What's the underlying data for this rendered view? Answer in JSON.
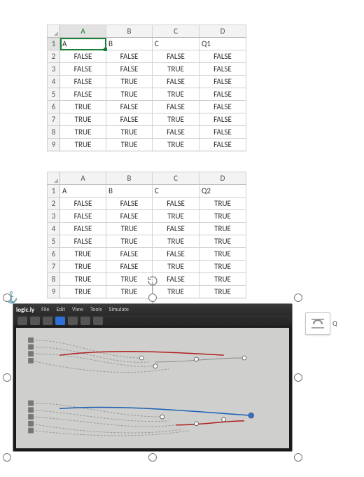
{
  "tables": [
    {
      "active_cell": {
        "row": 0,
        "col": 0
      },
      "columns": [
        "A",
        "B",
        "C",
        "D"
      ],
      "rows": [
        "1",
        "2",
        "3",
        "4",
        "5",
        "6",
        "7",
        "8",
        "9"
      ],
      "header_row": [
        "A",
        "B",
        "C",
        "Q1"
      ],
      "data": [
        [
          "FALSE",
          "FALSE",
          "FALSE",
          "FALSE"
        ],
        [
          "FALSE",
          "FALSE",
          "TRUE",
          "FALSE"
        ],
        [
          "FALSE",
          "TRUE",
          "FALSE",
          "FALSE"
        ],
        [
          "FALSE",
          "TRUE",
          "TRUE",
          "FALSE"
        ],
        [
          "TRUE",
          "FALSE",
          "FALSE",
          "FALSE"
        ],
        [
          "TRUE",
          "FALSE",
          "TRUE",
          "FALSE"
        ],
        [
          "TRUE",
          "TRUE",
          "FALSE",
          "FALSE"
        ],
        [
          "TRUE",
          "TRUE",
          "TRUE",
          "FALSE"
        ]
      ]
    },
    {
      "columns": [
        "A",
        "B",
        "C",
        "D"
      ],
      "rows": [
        "1",
        "2",
        "3",
        "4",
        "5",
        "6",
        "7",
        "8",
        "9"
      ],
      "header_row": [
        "A",
        "B",
        "C",
        "Q2"
      ],
      "data": [
        [
          "FALSE",
          "FALSE",
          "FALSE",
          "TRUE"
        ],
        [
          "FALSE",
          "FALSE",
          "TRUE",
          "TRUE"
        ],
        [
          "FALSE",
          "TRUE",
          "FALSE",
          "TRUE"
        ],
        [
          "FALSE",
          "TRUE",
          "TRUE",
          "TRUE"
        ],
        [
          "TRUE",
          "FALSE",
          "FALSE",
          "TRUE"
        ],
        [
          "TRUE",
          "FALSE",
          "TRUE",
          "TRUE"
        ],
        [
          "TRUE",
          "TRUE",
          "FALSE",
          "TRUE"
        ],
        [
          "TRUE",
          "TRUE",
          "TRUE",
          "TRUE"
        ]
      ]
    }
  ],
  "embedded": {
    "brand": "logic.ly",
    "menus": [
      "File",
      "Edit",
      "View",
      "Tools",
      "Simulate"
    ]
  },
  "flyout_label": "Q"
}
